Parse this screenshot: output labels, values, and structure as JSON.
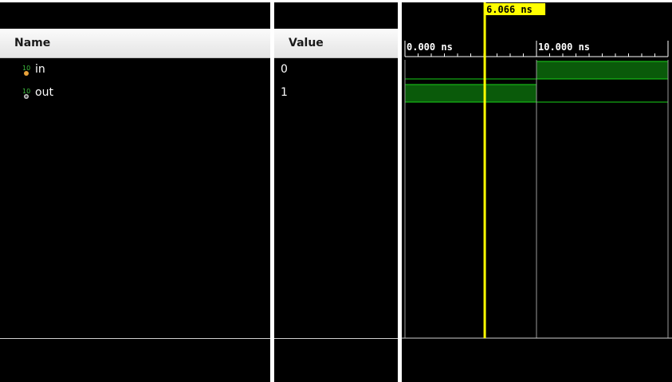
{
  "columns": {
    "name_header": "Name",
    "value_header": "Value"
  },
  "signals": [
    {
      "name": "in",
      "value": "0",
      "icon": "input-port-icon",
      "icon_dot_color": "#e8a23a"
    },
    {
      "name": "out",
      "value": "1",
      "icon": "output-port-icon",
      "icon_dot_color": "#c8c8c8"
    }
  ],
  "timeline": {
    "time_unit": "ns",
    "range_ns": [
      0,
      20
    ],
    "tick_labels": [
      "0.000 ns",
      "10.000 ns"
    ],
    "cursor_label": "6.066 ns",
    "cursor_time_ns": 6.066
  },
  "waveforms": {
    "in": [
      {
        "from": 0,
        "to": 10,
        "value": 0
      },
      {
        "from": 10,
        "to": 20,
        "value": 1
      }
    ],
    "out": [
      {
        "from": 0,
        "to": 10,
        "value": 1
      },
      {
        "from": 10,
        "to": 20,
        "value": 0
      }
    ]
  },
  "colors": {
    "background": "#000000",
    "wave_line": "#19d219",
    "wave_fill": "#0a5a0a",
    "cursor": "#ffff00",
    "icon_green": "#3fbf3f"
  }
}
